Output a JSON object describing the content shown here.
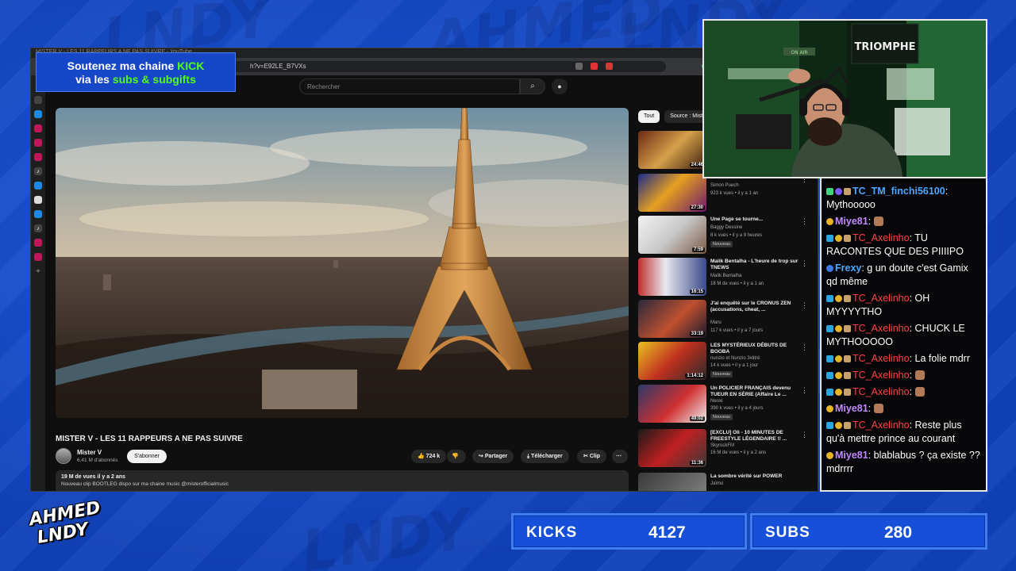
{
  "overlay": {
    "bg_words": [
      "AHMED",
      "LNDY"
    ],
    "logo_lines": [
      "AHMED",
      "LNDY"
    ],
    "kick_banner": {
      "line1_pre": "Soutenez ma chaine ",
      "line1_kick": "KICK",
      "line2_pre": "via les ",
      "line2_highlight": "subs & subgifts"
    },
    "stats": {
      "kicks_label": "KICKS",
      "kicks_value": "4127",
      "subs_label": "SUBS",
      "subs_value": "280"
    },
    "webcam_signs": {
      "neon": "TRIOMPHE",
      "onair": "ON AIR"
    }
  },
  "browser": {
    "tab_title": "MISTER V - LES 11 RAPPEURS A NE PAS SUIVRE - YouTube",
    "url": "h?v=E92LE_B7VXs"
  },
  "youtube": {
    "search_placeholder": "Rechercher",
    "video": {
      "title": "MISTER V - LES 11 RAPPEURS A NE PAS SUIVRE",
      "channel": "Mister V",
      "subs": "6,41 M d'abonnés",
      "subscribe_label": "S'abonner",
      "likes": "724 k",
      "share_label": "Partager",
      "download_label": "Télécharger",
      "clip_label": "Clip",
      "views_date": "19 M de vues  il y a 2 ans",
      "description": "Nouveau clip BOOTLEG dispo sur ma chaine music @misterofficialmusic"
    },
    "chips": [
      "Tout",
      "Source : Mister"
    ],
    "recommendations": [
      {
        "title": "",
        "channel": "",
        "meta": "",
        "duration": "24:46",
        "badge": ""
      },
      {
        "title": "",
        "channel": "Simon Puech",
        "meta": "923 k vues • il y a 1 an",
        "duration": "27:30",
        "badge": ""
      },
      {
        "title": "Une Page se tourne...",
        "channel": "Baggy Dessine",
        "meta": "8 k vues • il y a 9 heures",
        "duration": "7:59",
        "badge": "Nouveau"
      },
      {
        "title": "Malik Bentalha - L'heure de trop sur TNEWS",
        "channel": "Malik Bentalha",
        "meta": "18 M de vues • il y a 1 an",
        "duration": "16:15",
        "badge": ""
      },
      {
        "title": "J'ai enquêté sur le CRONUS ZEN (accusations, cheat, ...",
        "channel": "Maru",
        "meta": "117 k vues • il y a 7 jours",
        "duration": "33:19",
        "badge": ""
      },
      {
        "title": "LES MYSTÉRIEUX DÉBUTS DE BOOBA",
        "channel": "nunzio et Nunzio 3xlitré",
        "meta": "14 k vues • il y a 1 jour",
        "duration": "1:14:12",
        "badge": "Nouveau"
      },
      {
        "title": "Un POLICIER FRANÇAIS devenu TUEUR EN SÉRIE (Affaire Le ...",
        "channel": "Neoxi",
        "meta": "390 k vues • il y a 4 jours",
        "duration": "49:02",
        "badge": "Nouveau"
      },
      {
        "title": "[EXCLU] Oli - 10 MINUTES DE FREESTYLE LÉGENDAIRE !! ...",
        "channel": "SkyrockFM",
        "meta": "16 M de vues • il y a 2 ans",
        "duration": "11:36",
        "badge": ""
      },
      {
        "title": "La sombre vérité sur POWER",
        "channel": "Jaïmo",
        "meta": "",
        "duration": "",
        "badge": ""
      }
    ]
  },
  "chat": [
    {
      "user": "TC_TM_finchi56100",
      "color": "blue",
      "text": ": Mythooooo"
    },
    {
      "user": "Miye81",
      "color": "violet",
      "text": ": "
    },
    {
      "user": "TC_Axelinho",
      "color": "red",
      "text": ": TU RACONTES QUE DES PIIIIPO"
    },
    {
      "user": "Frexy",
      "color": "blue",
      "text": ": g un doute c'est Gamix qd même"
    },
    {
      "user": "TC_Axelinho",
      "color": "red",
      "text": ": OH MYYYYTHO"
    },
    {
      "user": "TC_Axelinho",
      "color": "red",
      "text": ": CHUCK LE MYTHOOOOO"
    },
    {
      "user": "TC_Axelinho",
      "color": "red",
      "text": ": La folie mdrr"
    },
    {
      "user": "TC_Axelinho",
      "color": "red",
      "text": ": "
    },
    {
      "user": "TC_Axelinho",
      "color": "red",
      "text": ": "
    },
    {
      "user": "Miye81",
      "color": "violet",
      "text": ": "
    },
    {
      "user": "TC_Axelinho",
      "color": "red",
      "text": ": Reste plus qu'à mettre prince au courant"
    },
    {
      "user": "Miye81",
      "color": "violet",
      "text": ": blablabus ? ça existe ?? mdrrrr"
    }
  ],
  "colors": {
    "bg": "#1348c8",
    "kick_green": "#53fc18",
    "chat_red": "#ff4242",
    "chat_blue": "#4aa8ff",
    "chat_violet": "#c089ff"
  }
}
